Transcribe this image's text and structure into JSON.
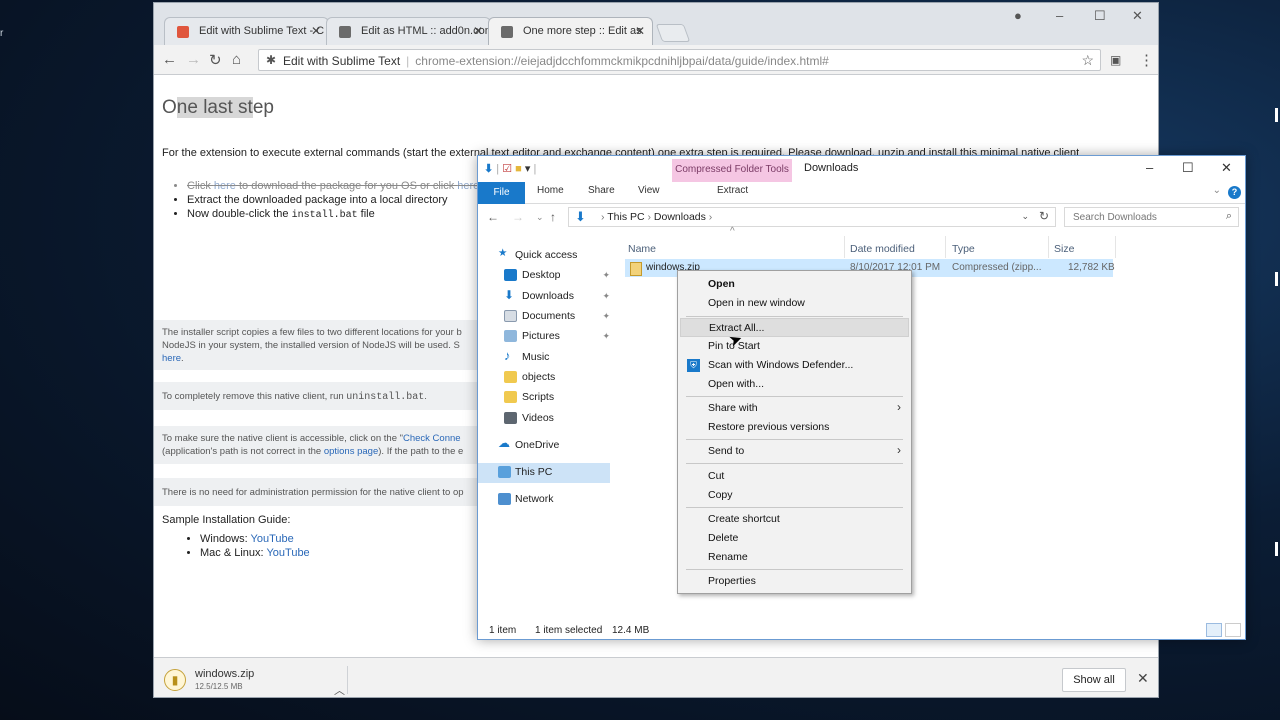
{
  "desktop": {
    "edge_glyph": "r"
  },
  "browser": {
    "tabs": [
      {
        "label": "Edit with Sublime Text - C",
        "favicon_color": "#e0563d"
      },
      {
        "label": "Edit as HTML :: add0n.com",
        "favicon_color": "#6b6b6b"
      },
      {
        "label": "One more step :: Edit as",
        "favicon_color": "#6b6b6b"
      }
    ],
    "address": {
      "extension_name": "Edit with Sublime Text",
      "url": "chrome-extension://eiejadjdcchfommckmikpcdnihljbpai/data/guide/index.html#"
    }
  },
  "page": {
    "heading_pre": "O",
    "heading_mid": "ne last st",
    "heading_post": "ep",
    "intro": "For the extension to execute external commands (start the external text editor and exchange content) one extra step is required. Please download, unzip and install this minimal native client",
    "steps": {
      "step1_a": "Click ",
      "step1_link": "here",
      "step1_b": " to download the package for you OS or click ",
      "step1_link2": "here",
      "step2": "Extract the downloaded package into a local directory",
      "step3_a": "Now double-click the ",
      "step3_code": "install.bat",
      "step3_b": " file"
    },
    "panels": {
      "installer_l1": "The installer script copies a few files to two different locations for your b",
      "installer_l2": "NodeJS in your system, the installed version of NodeJS will be used. S",
      "installer_link": "here",
      "installer_end": ".",
      "remove_a": "To completely remove this native client, run ",
      "remove_code": "uninstall.bat",
      "remove_b": ".",
      "access_a": "To make sure the native client is accessible, click on the \"",
      "access_link": "Check Conne",
      "access_l2a": "(application's path is not correct in the ",
      "access_link2": "options page",
      "access_l2b": "). If the path to the e",
      "admin": "There is no need for administration permission for the native client to op"
    },
    "guide_title": "Sample Installation Guide:",
    "guide": [
      {
        "label": "Windows: ",
        "link": "YouTube"
      },
      {
        "label": "Mac & Linux: ",
        "link": "YouTube"
      }
    ]
  },
  "downloads": {
    "filename": "windows.zip",
    "progress": "12.5/12.5 MB",
    "show_all": "Show all"
  },
  "explorer": {
    "context_tab": "Compressed Folder Tools",
    "title": "Downloads",
    "ribbon": {
      "file": "File",
      "home": "Home",
      "share": "Share",
      "view": "View",
      "extract": "Extract"
    },
    "breadcrumb": {
      "this_pc": "This PC",
      "downloads": "Downloads"
    },
    "search_placeholder": "Search Downloads",
    "nav": {
      "quick_access": "Quick access",
      "desktop": "Desktop",
      "downloads": "Downloads",
      "documents": "Documents",
      "pictures": "Pictures",
      "music": "Music",
      "objects": "objects",
      "scripts": "Scripts",
      "videos": "Videos",
      "onedrive": "OneDrive",
      "this_pc": "This PC",
      "network": "Network"
    },
    "columns": {
      "name": "Name",
      "date": "Date modified",
      "type": "Type",
      "size": "Size"
    },
    "file": {
      "name": "windows.zip",
      "date": "8/10/2017 12:01 PM",
      "type": "Compressed (zipp...",
      "size": "12,782 KB"
    },
    "status": {
      "count": "1 item",
      "selected": "1 item selected",
      "size": "12.4 MB"
    }
  },
  "context_menu": {
    "open": "Open",
    "open_new_window": "Open in new window",
    "extract_all": "Extract All...",
    "pin_to_start": "Pin to Start",
    "scan": "Scan with Windows Defender...",
    "open_with": "Open with...",
    "share_with": "Share with",
    "restore": "Restore previous versions",
    "send_to": "Send to",
    "cut": "Cut",
    "copy": "Copy",
    "create_shortcut": "Create shortcut",
    "delete": "Delete",
    "rename": "Rename",
    "properties": "Properties"
  }
}
